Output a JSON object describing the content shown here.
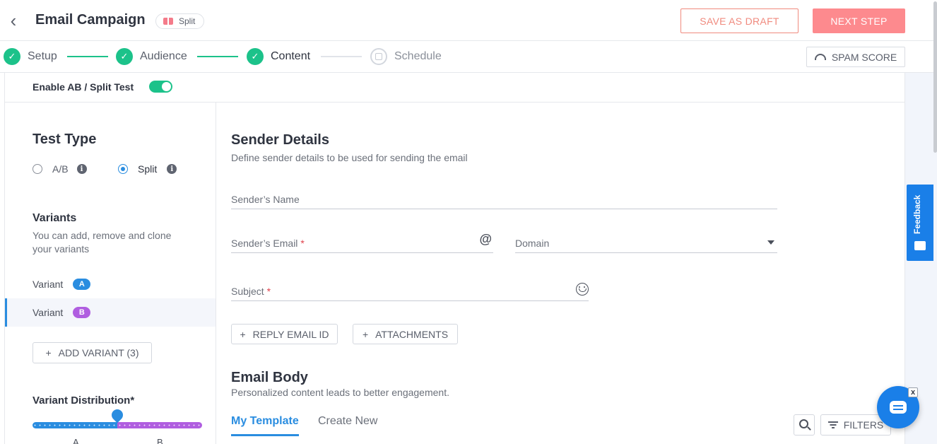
{
  "header": {
    "title": "Email Campaign",
    "type_badge": "Split",
    "save_draft_label": "SAVE AS DRAFT",
    "next_step_label": "NEXT STEP"
  },
  "stepper": {
    "steps": [
      {
        "label": "Setup",
        "state": "done"
      },
      {
        "label": "Audience",
        "state": "done"
      },
      {
        "label": "Content",
        "state": "active"
      },
      {
        "label": "Schedule",
        "state": "pending"
      }
    ],
    "spam_score_label": "SPAM SCORE",
    "check": "✓"
  },
  "ab_toggle": {
    "label": "Enable AB / Split Test",
    "enabled": true
  },
  "test_type": {
    "heading": "Test Type",
    "options": [
      {
        "label": "A/B",
        "selected": false
      },
      {
        "label": "Split",
        "selected": true
      }
    ],
    "info_glyph": "i"
  },
  "variants": {
    "heading": "Variants",
    "help": "You can add, remove and clone your variants",
    "items": [
      {
        "label": "Variant",
        "badge": "A",
        "badge_color": "#2a8de0",
        "selected": false
      },
      {
        "label": "Variant",
        "badge": "B",
        "badge_color": "#b05ee0",
        "selected": true
      }
    ],
    "add_label": "ADD VARIANT (3)",
    "plus": "+"
  },
  "distribution": {
    "heading": "Variant Distribution*",
    "a_label": "A",
    "b_label": "B",
    "a_percent": 50
  },
  "sender": {
    "heading": "Sender Details",
    "help": "Define sender details to be used for sending the email",
    "name_placeholder": "Sender’s Name",
    "email_placeholder": "Sender’s Email",
    "domain_placeholder": "Domain",
    "subject_placeholder": "Subject",
    "required_mark": "*",
    "at_glyph": "@",
    "reply_label": "REPLY EMAIL ID",
    "attachments_label": "ATTACHMENTS",
    "plus": "+"
  },
  "email_body": {
    "heading": "Email Body",
    "help": "Personalized content leads to better engagement.",
    "tabs": [
      {
        "label": "My Template",
        "active": true
      },
      {
        "label": "Create New",
        "active": false
      }
    ],
    "filters_label": "FILTERS"
  },
  "feedback_label": "Feedback",
  "chat_close": "x",
  "colors": {
    "accent": "#2a8de0",
    "success": "#1cc28a",
    "danger": "#fd8a8e",
    "variant_b": "#b05ee0"
  }
}
